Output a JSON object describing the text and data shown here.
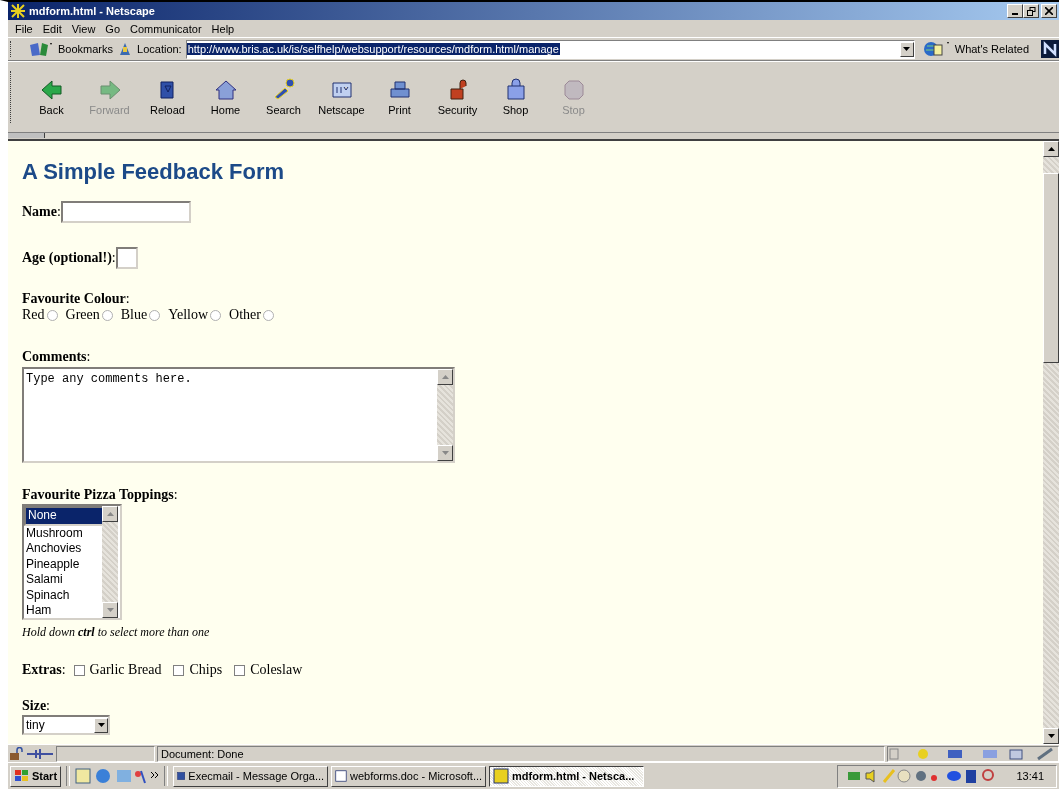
{
  "window": {
    "title": "mdform.html - Netscape"
  },
  "menu": [
    "File",
    "Edit",
    "View",
    "Go",
    "Communicator",
    "Help"
  ],
  "location_bar": {
    "bookmarks": "Bookmarks",
    "label": "Location:",
    "url": "http://www.bris.ac.uk/is/selfhelp/websupport/resources/mdform.html/manage",
    "whats_related": "What's Related"
  },
  "toolbar": [
    {
      "label": "Back",
      "disabled": false
    },
    {
      "label": "Forward",
      "disabled": true
    },
    {
      "label": "Reload",
      "disabled": false
    },
    {
      "label": "Home",
      "disabled": false
    },
    {
      "label": "Search",
      "disabled": false
    },
    {
      "label": "Netscape",
      "disabled": false
    },
    {
      "label": "Print",
      "disabled": false
    },
    {
      "label": "Security",
      "disabled": false
    },
    {
      "label": "Shop",
      "disabled": false
    },
    {
      "label": "Stop",
      "disabled": true
    }
  ],
  "page": {
    "heading": "A Simple Feedback Form",
    "name_label": "**Name**:",
    "age_label": "**Age (optional!)**:",
    "colour_label": "**Favourite Colour**:",
    "colours": [
      {
        "label": "Red",
        "selected": false
      },
      {
        "label": "Green",
        "selected": false
      },
      {
        "label": "Blue",
        "selected": false
      },
      {
        "label": "Yellow",
        "selected": false
      },
      {
        "label": "Other",
        "selected": false
      }
    ],
    "comments_label": "**Comments**:",
    "comments_value": "Type any comments here.",
    "toppings_label": "**Favourite Pizza Toppings**:",
    "toppings": [
      {
        "label": "None",
        "selected": true
      },
      {
        "label": "Mushroom",
        "selected": false
      },
      {
        "label": "Anchovies",
        "selected": false
      },
      {
        "label": "Pineapple",
        "selected": false
      },
      {
        "label": "Salami",
        "selected": false
      },
      {
        "label": "Spinach",
        "selected": false
      },
      {
        "label": "Ham",
        "selected": false
      }
    ],
    "toppings_hint": "Hold down **ctrl** to select more than one",
    "extras_label": "**Extras**:",
    "extras": [
      {
        "label": "Garlic Bread",
        "checked": false
      },
      {
        "label": "Chips",
        "checked": false
      },
      {
        "label": "Coleslaw",
        "checked": false
      }
    ],
    "size_label": "**Size**:",
    "size_value": "tiny"
  },
  "status_bar": {
    "text": "Document: Done"
  },
  "taskbar": {
    "start": "Start",
    "tasks": [
      {
        "label": "Execmail - Message Orga...",
        "selected": false
      },
      {
        "label": "webforms.doc - Microsoft...",
        "selected": false
      },
      {
        "label": "mdform.html - Netsca...",
        "selected": true
      }
    ],
    "clock": "13:41"
  }
}
